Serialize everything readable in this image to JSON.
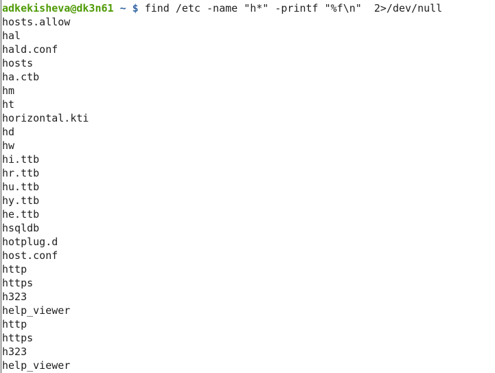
{
  "prompt": {
    "user_host": "adkekisheva@dk3n61",
    "path": "~",
    "symbol": "$",
    "command": "find /etc -name \"h*\" -printf \"%f\\n\"  2>/dev/null"
  },
  "output": [
    "hosts.allow",
    "hal",
    "hald.conf",
    "hosts",
    "ha.ctb",
    "hm",
    "ht",
    "horizontal.kti",
    "hd",
    "hw",
    "hi.ttb",
    "hr.ttb",
    "hu.ttb",
    "hy.ttb",
    "he.ttb",
    "hsqldb",
    "hotplug.d",
    "host.conf",
    "http",
    "https",
    "h323",
    "help_viewer",
    "http",
    "https",
    "h323",
    "help_viewer"
  ],
  "colors": {
    "user_host": "#4e9a06",
    "path": "#3465a4",
    "text": "#1e1e1e",
    "background": "#ffffff"
  }
}
